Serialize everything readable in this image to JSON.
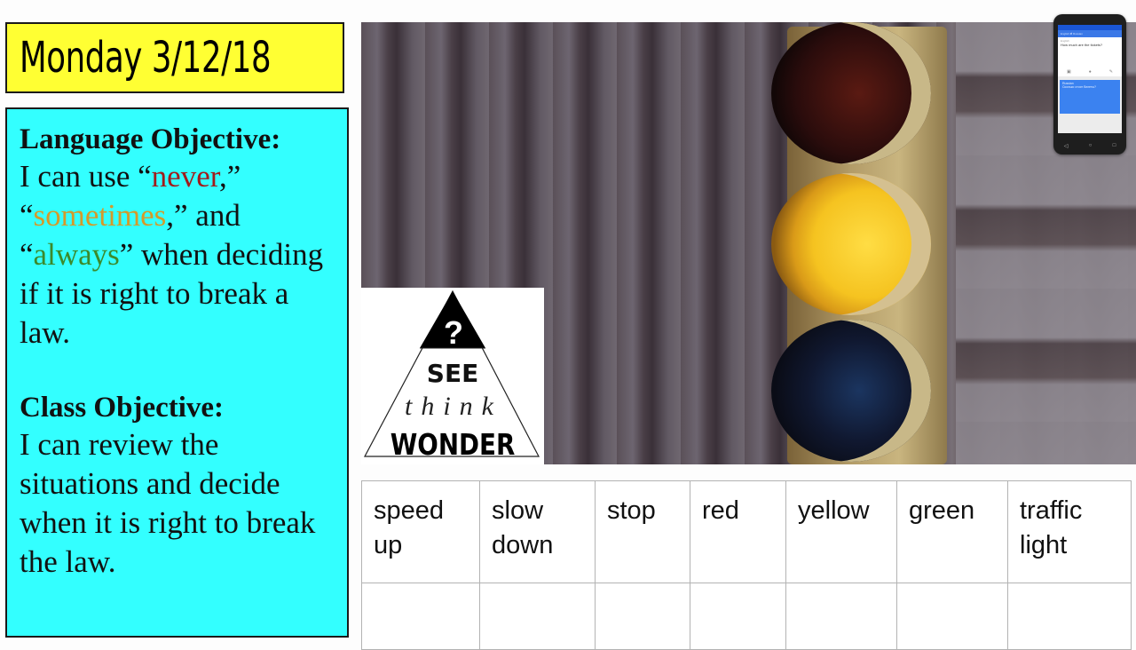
{
  "date_title": "Monday 3/12/18",
  "language_objective": {
    "heading": "Language Objective:",
    "text_1": "I can use “",
    "word_never": "never",
    "text_2": ",” “",
    "word_sometimes": "sometimes",
    "text_3": ",” and “",
    "word_always": "always",
    "text_4": "” when deciding if it is right to break a law.",
    "colors": {
      "never": "#a11c1c",
      "sometimes": "#d49a2a",
      "always": "#3c8a2c"
    }
  },
  "class_objective": {
    "heading": "Class Objective:",
    "text": "I can review the situations and decide when it is right to break the law."
  },
  "photo": {
    "subject": "traffic-light",
    "active_light": "yellow"
  },
  "see_think_wonder": {
    "see": "SEE",
    "think": "think",
    "wonder": "WONDER",
    "symbol": "?"
  },
  "phone": {
    "lang_from": "English",
    "lang_to": "Russian",
    "input_label": "English",
    "input_text": "How much are the tickets?",
    "result_label": "Russian",
    "result_text": "Сколько стоят билеты?"
  },
  "vocab_table": {
    "words": [
      "speed up",
      "slow down",
      "stop",
      "red",
      "yellow",
      "green",
      "traffic light"
    ],
    "answers": [
      "",
      "",
      "",
      "",
      "",
      "",
      ""
    ]
  },
  "colors": {
    "date_bg": "#ffff33",
    "objectives_bg": "#33ffff"
  }
}
